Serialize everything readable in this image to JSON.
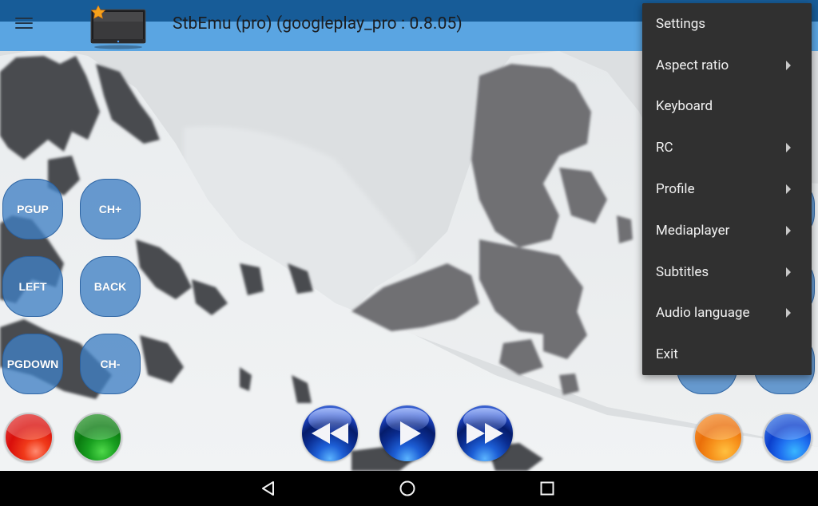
{
  "app_bar": {
    "title": "StbEmu (pro) (googleplay_pro : 0.8.05)",
    "menu_icon": "hamburger-menu-icon",
    "logo_icon": "tv-with-star-icon"
  },
  "rc_buttons": {
    "pgup": "PGUP",
    "ch_plus": "CH+",
    "left": "LEFT",
    "back": "BACK",
    "pgdown": "PGDOWN",
    "ch_minus": "CH-"
  },
  "color_buttons": [
    {
      "name": "red",
      "color": "#e0211c"
    },
    {
      "name": "green",
      "color": "#16921c"
    },
    {
      "name": "yellow",
      "color": "#f4851a"
    },
    {
      "name": "blue",
      "color": "#1f62e6"
    }
  ],
  "media_controls": {
    "rewind_icon": "rewind-icon",
    "play_icon": "play-icon",
    "fast_forward_icon": "fast-forward-icon"
  },
  "overflow_menu": {
    "items": [
      {
        "label": "Settings",
        "submenu": false
      },
      {
        "label": "Aspect ratio",
        "submenu": true
      },
      {
        "label": "Keyboard",
        "submenu": false
      },
      {
        "label": "RC",
        "submenu": true
      },
      {
        "label": "Profile",
        "submenu": true
      },
      {
        "label": "Mediaplayer",
        "submenu": true
      },
      {
        "label": "Subtitles",
        "submenu": true
      },
      {
        "label": "Audio language",
        "submenu": true
      },
      {
        "label": "Exit",
        "submenu": false
      }
    ]
  },
  "nav_bar": {
    "back_icon": "nav-back-icon",
    "home_icon": "nav-home-icon",
    "recents_icon": "nav-recents-icon"
  },
  "colors": {
    "app_bar_dark": "#175c98",
    "app_bar_light": "#5aa5e2",
    "menu_background": "#303030",
    "rc_button": "#4080c4"
  }
}
